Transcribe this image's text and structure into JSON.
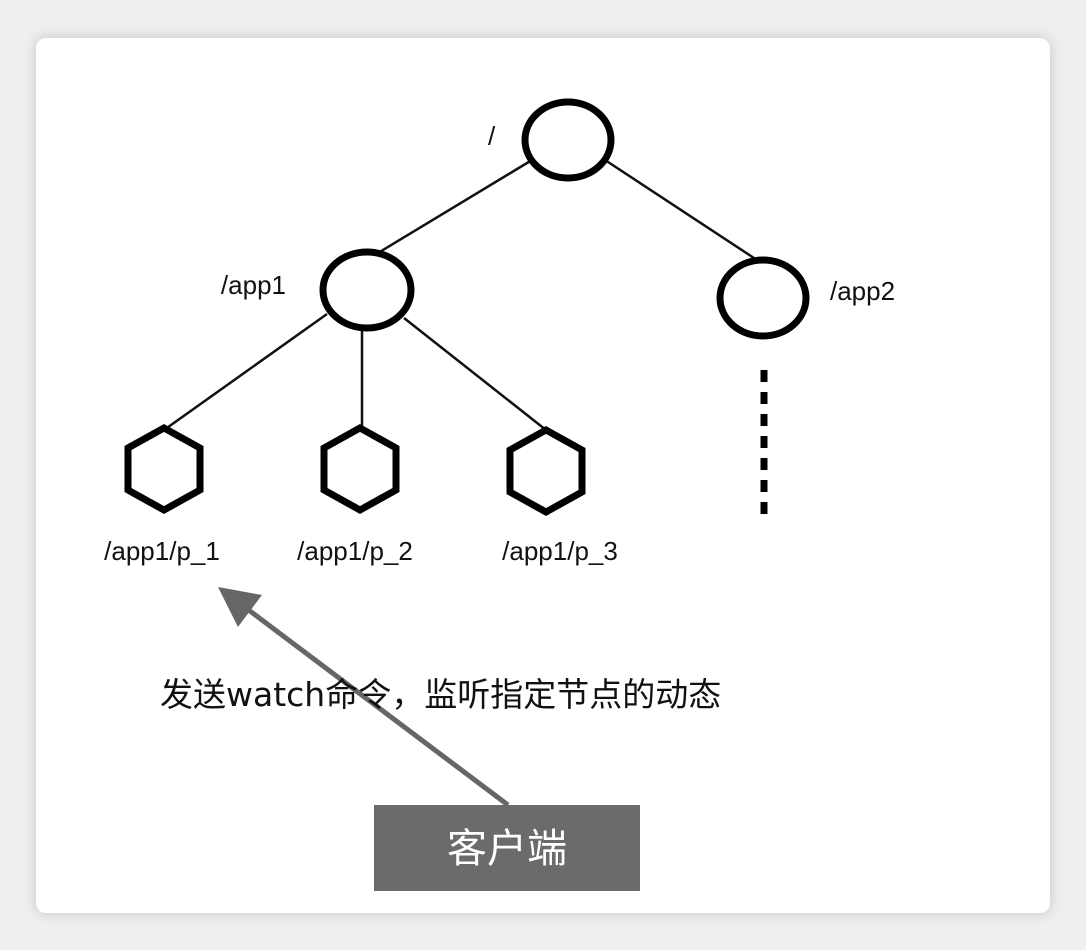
{
  "tree": {
    "root_label": "/",
    "app1_label": "/app1",
    "app2_label": "/app2",
    "children": [
      "/app1/p_1",
      "/app1/p_2",
      "/app1/p_3"
    ]
  },
  "annotation": "发送watch命令，监听指定节点的动态",
  "client_label": "客户端",
  "colors": {
    "client_box": "#6b6b6b",
    "arrow": "#666666",
    "node_stroke": "#000000"
  }
}
